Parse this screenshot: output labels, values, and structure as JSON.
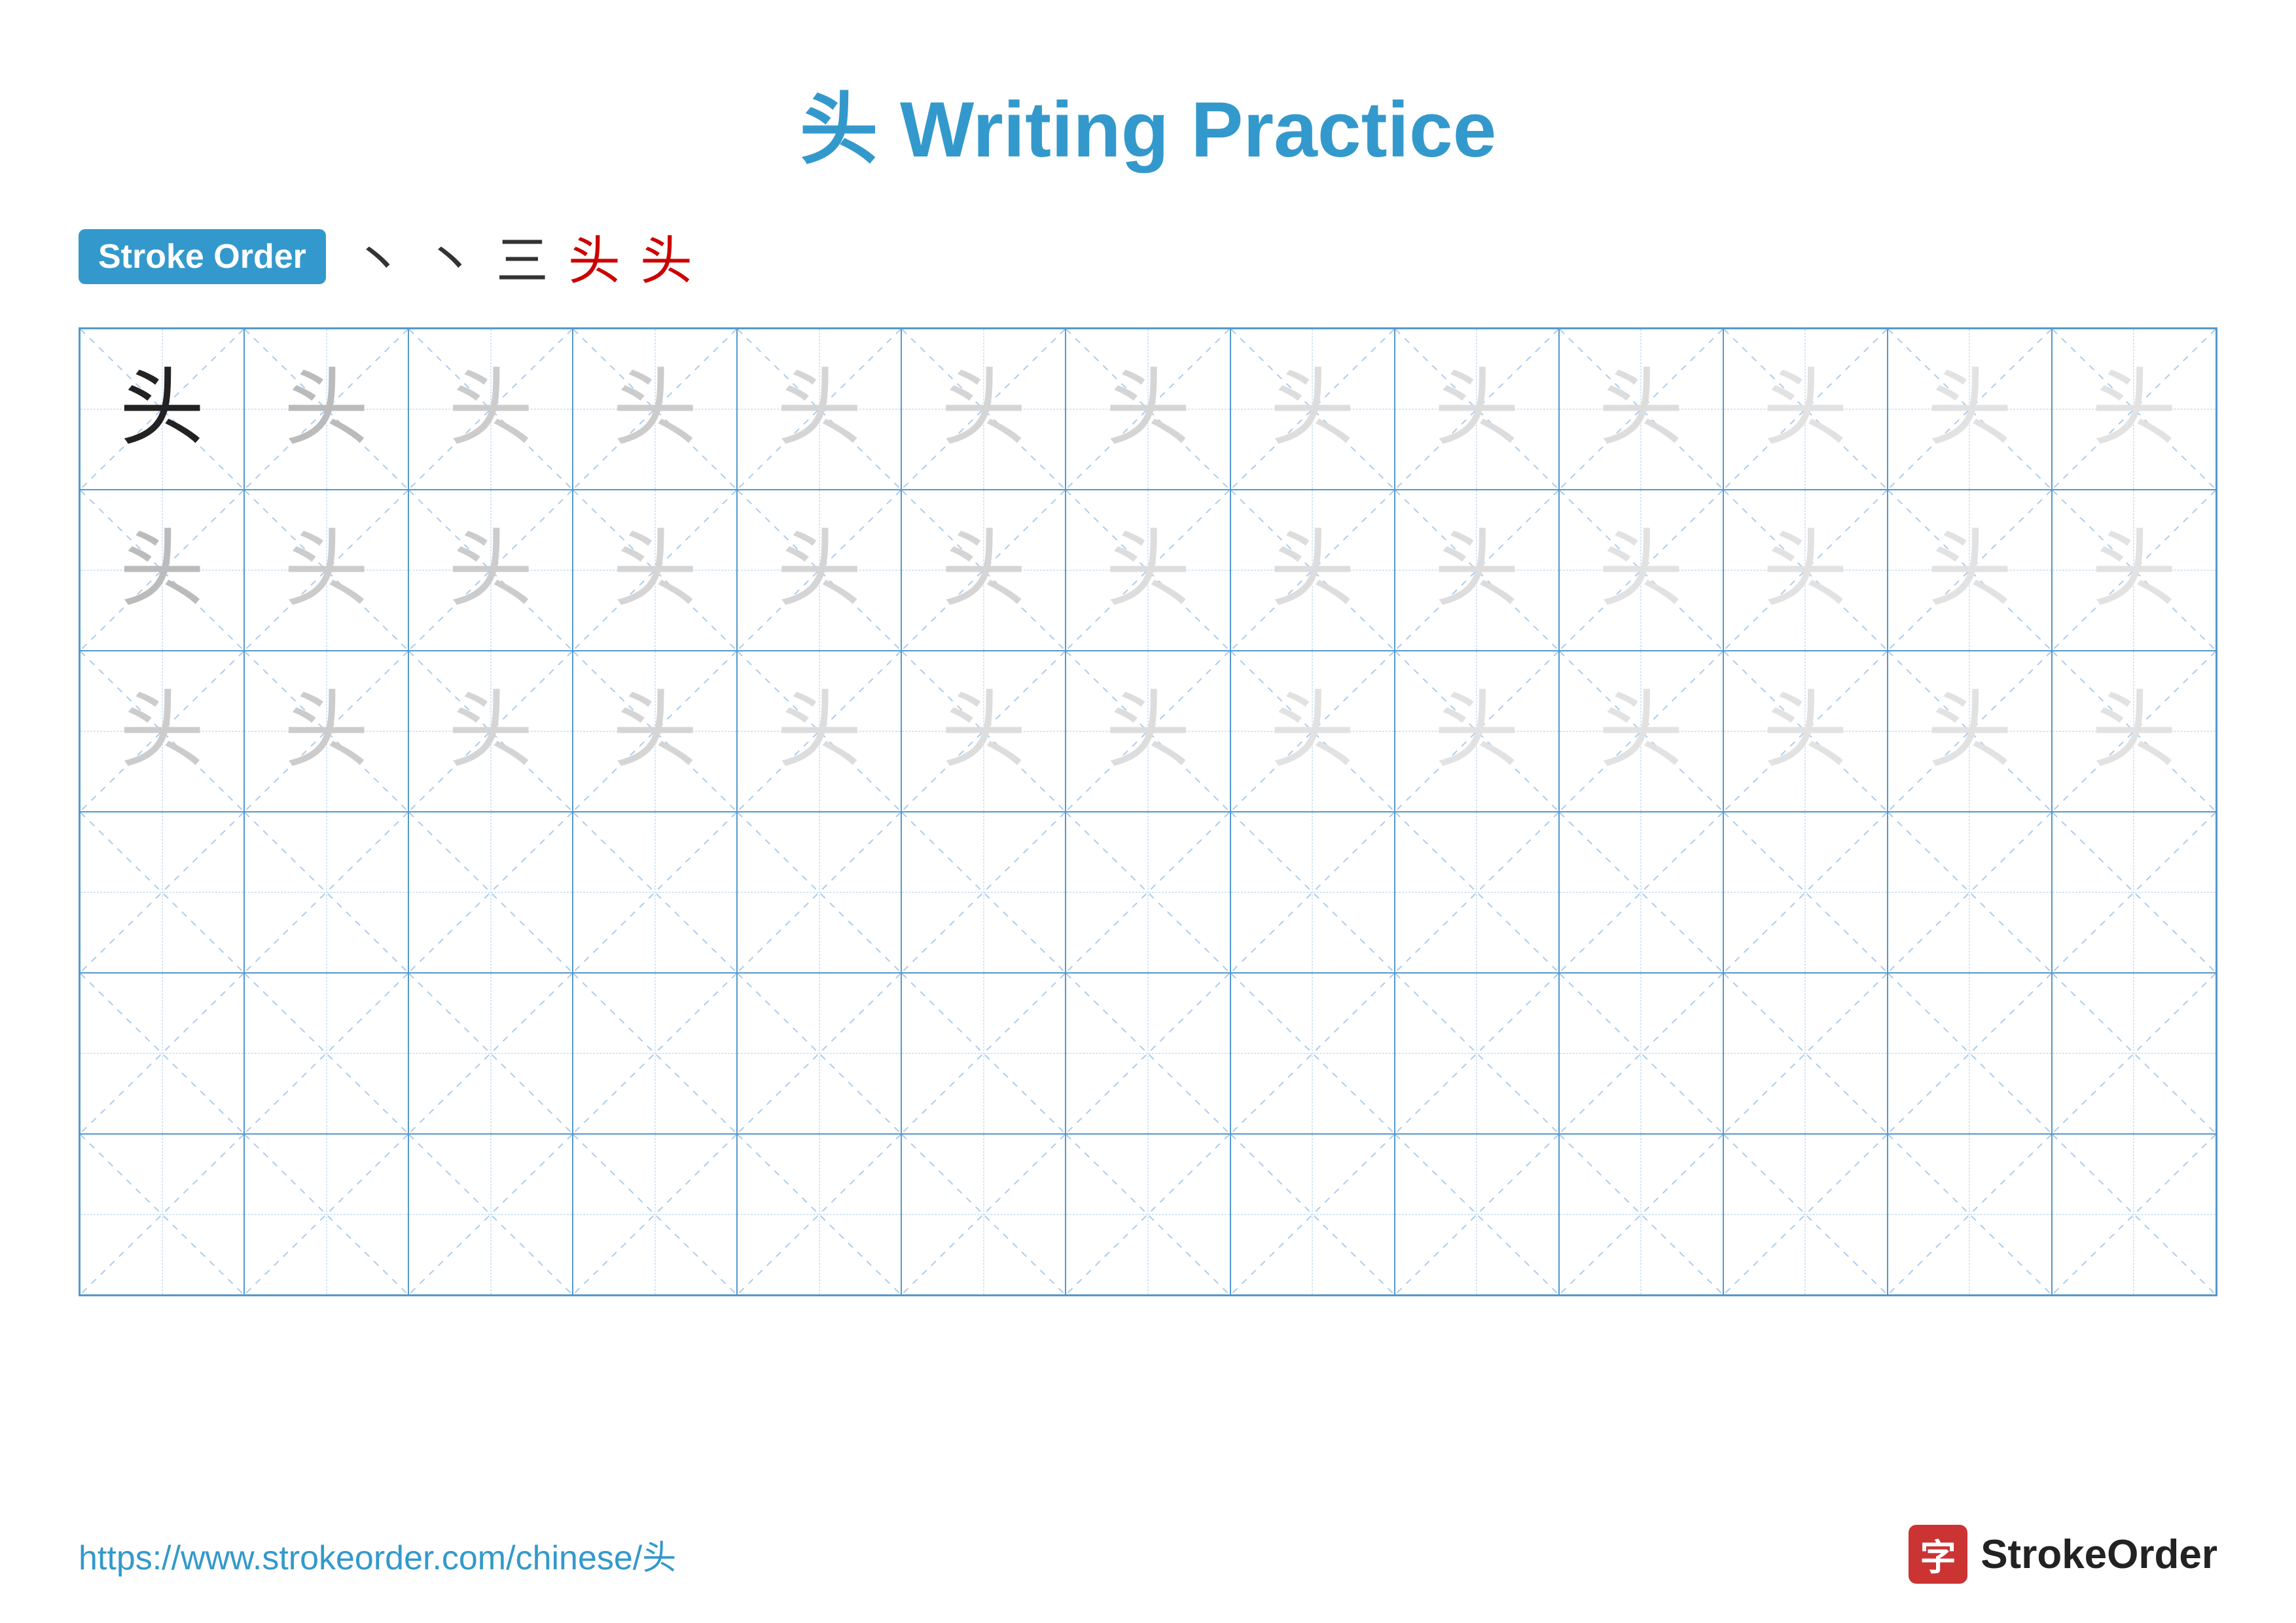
{
  "page": {
    "title": "头 Writing Practice",
    "stroke_order_label": "Stroke Order",
    "stroke_steps": [
      "丶",
      "丶",
      "三",
      "头",
      "头"
    ],
    "character": "头",
    "footer_url": "https://www.strokeorder.com/chinese/头",
    "footer_logo_char": "字",
    "footer_logo_name": "StrokeOrder",
    "colors": {
      "blue": "#3399cc",
      "dark_char": "#222222",
      "light_char": "#cccccc",
      "red": "#cc0000"
    }
  },
  "grid": {
    "rows": 6,
    "cols": 13,
    "filled_rows": 3
  }
}
